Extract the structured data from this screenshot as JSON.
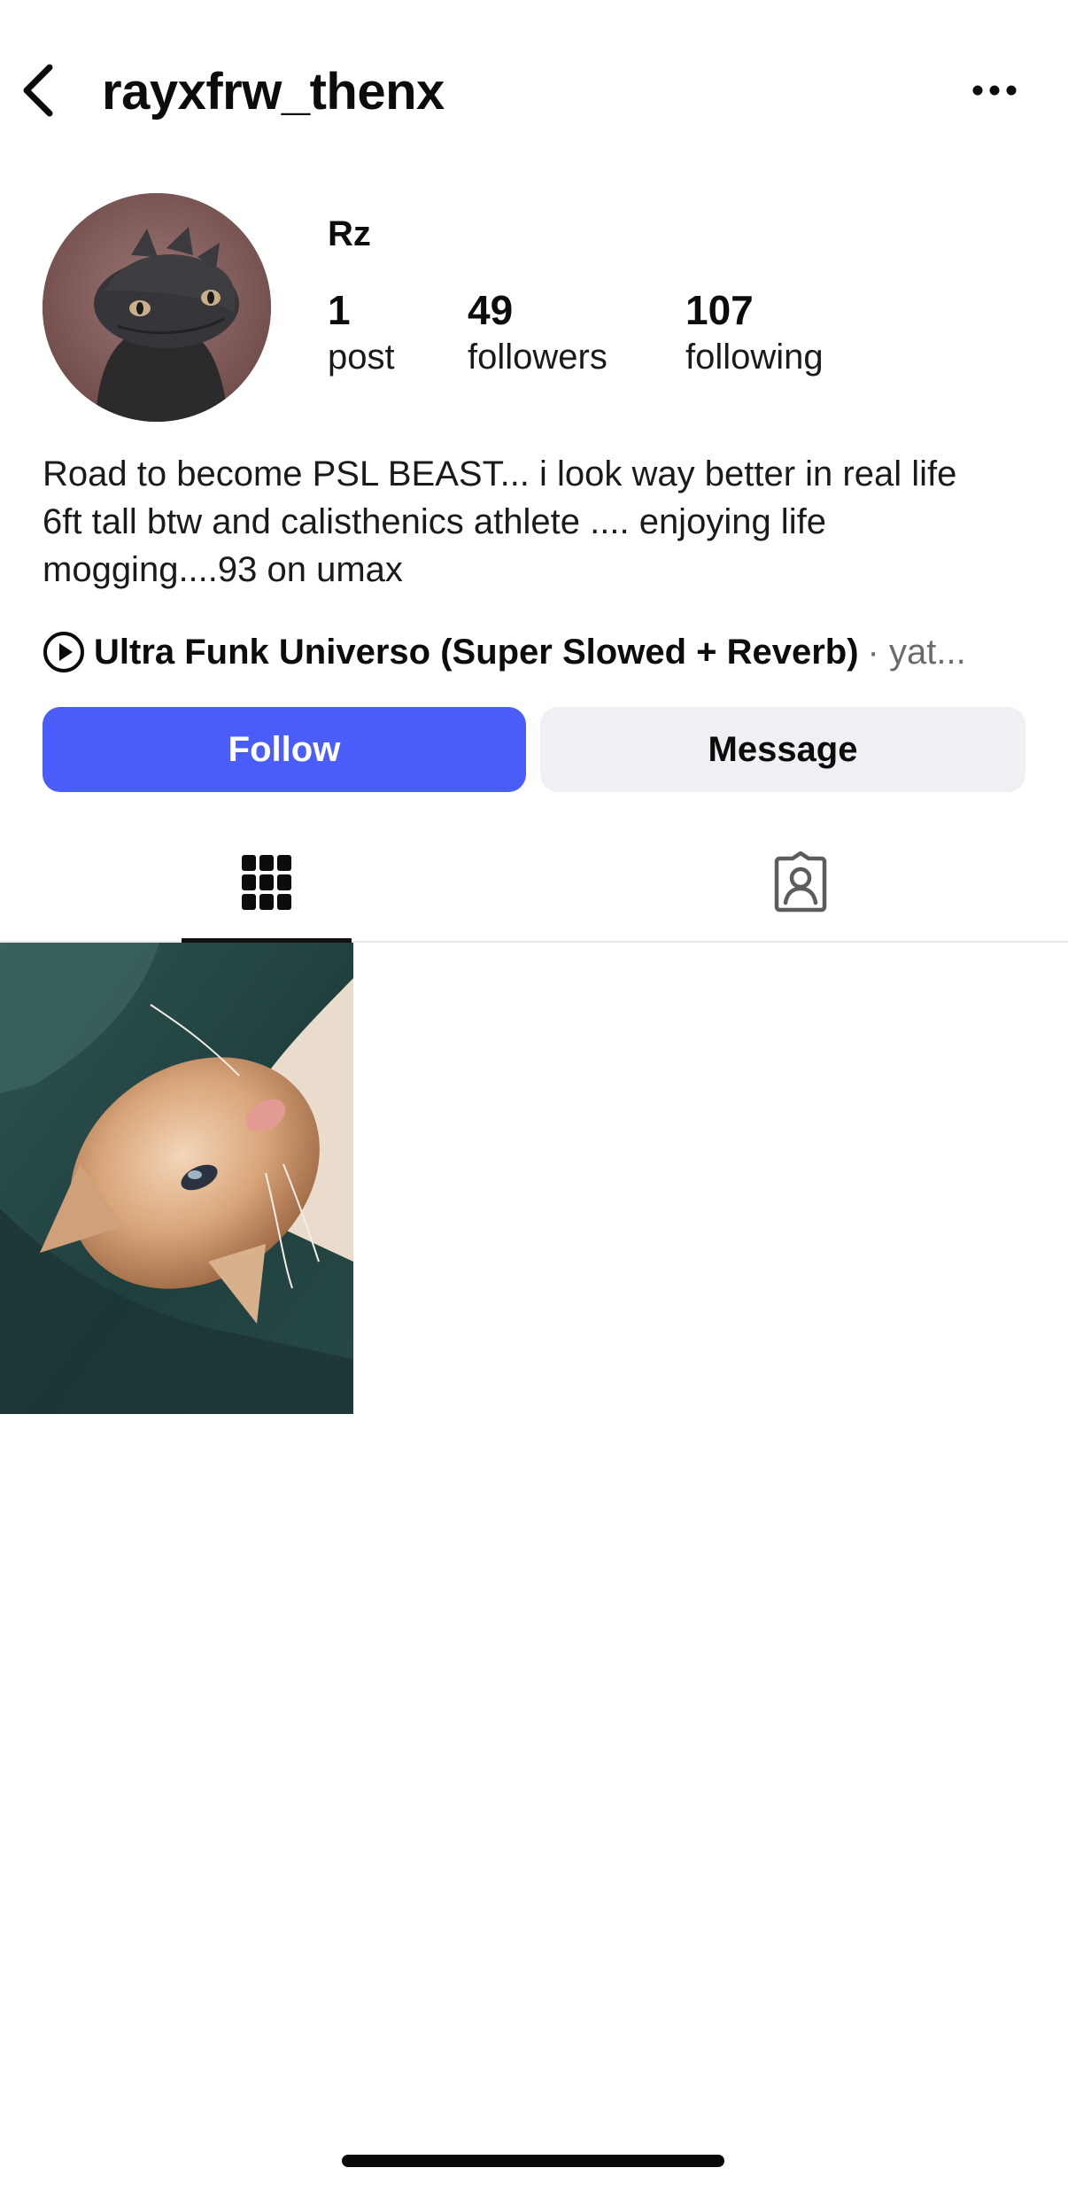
{
  "header": {
    "username": "rayxfrw_thenx",
    "back_icon": "chevron-left-icon",
    "more_icon": "more-horizontal-icon"
  },
  "profile": {
    "display_name": "Rz",
    "avatar_description": "profile-avatar",
    "stats": [
      {
        "value": "1",
        "label": "post"
      },
      {
        "value": "49",
        "label": "followers"
      },
      {
        "value": "107",
        "label": "following"
      }
    ],
    "bio": "Road to become PSL BEAST... i look way better in real life\n6ft tall btw and calisthenics athlete .... enjoying life\nmogging....93 on umax"
  },
  "music": {
    "icon": "play-circle-icon",
    "title": "Ultra Funk Universo (Super Slowed + Reverb)",
    "artist": "· yat..."
  },
  "actions": {
    "follow_label": "Follow",
    "message_label": "Message"
  },
  "tabs": [
    {
      "icon": "grid-icon",
      "active": true
    },
    {
      "icon": "tagged-person-icon",
      "active": false
    }
  ],
  "colors": {
    "accent": "#4a5df9",
    "secondary_button": "#eff0f4",
    "muted_text": "#6b6b6b"
  }
}
